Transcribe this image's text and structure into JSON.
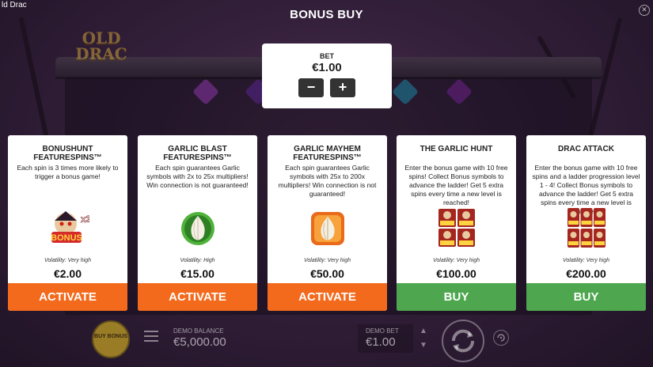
{
  "window": {
    "title": "ld Drac"
  },
  "logo": {
    "text": "OLD DRAC"
  },
  "header": {
    "title": "BONUS BUY"
  },
  "bet": {
    "label": "BET",
    "value": "€1.00",
    "minus": "−",
    "plus": "+"
  },
  "cards": [
    {
      "title": "BONUSHUNT FEATURESPINS™",
      "description": "Each spin is 3 times more likely to trigger a bonus game!",
      "icon": "bonus-x3-icon",
      "volatility": "Volatility: Very high",
      "price": "€2.00",
      "action": "ACTIVATE"
    },
    {
      "title": "GARLIC BLAST FEATURESPINS™",
      "description": "Each spin guarantees Garlic symbols with 2x to 25x multipliers! Win connection is not guaranteed!",
      "icon": "green-garlic-icon",
      "volatility": "Volatility: High",
      "price": "€15.00",
      "action": "ACTIVATE"
    },
    {
      "title": "GARLIC MAYHEM FEATURESPINS™",
      "description": "Each spin guarantees Garlic symbols with 25x to 200x multipliers! Win connection is not guaranteed!",
      "icon": "orange-garlic-icon",
      "volatility": "Volatility: Very high",
      "price": "€50.00",
      "action": "ACTIVATE"
    },
    {
      "title": "THE GARLIC HUNT",
      "description": "Enter the bonus game with 10 free spins! Collect Bonus symbols to advance the ladder! Get 5 extra spins every time a new level is reached!",
      "icon": "bonus-stack-4-icon",
      "volatility": "Volatility: Very high",
      "price": "€100.00",
      "action": "BUY"
    },
    {
      "title": "DRAC ATTACK",
      "description": "Enter the bonus game with 10 free spins and a ladder progression level 1 - 4! Collect Bonus symbols to advance the ladder! Get 5 extra spins every time a new level is reached!",
      "icon": "bonus-stack-6-icon",
      "volatility": "Volatility: Very high",
      "price": "€200.00",
      "action": "BUY"
    }
  ],
  "footer": {
    "buy_bonus": "BUY BONUS",
    "demo_balance_label": "DEMO BALANCE",
    "demo_balance_value": "€5,000.00",
    "demo_bet_label": "DEMO BET",
    "demo_bet_value": "€1.00"
  },
  "colors": {
    "activate": "#f36a1d",
    "buy": "#4ea64f",
    "card_bg": "#ffffff",
    "backdrop": "#4a2d52"
  }
}
